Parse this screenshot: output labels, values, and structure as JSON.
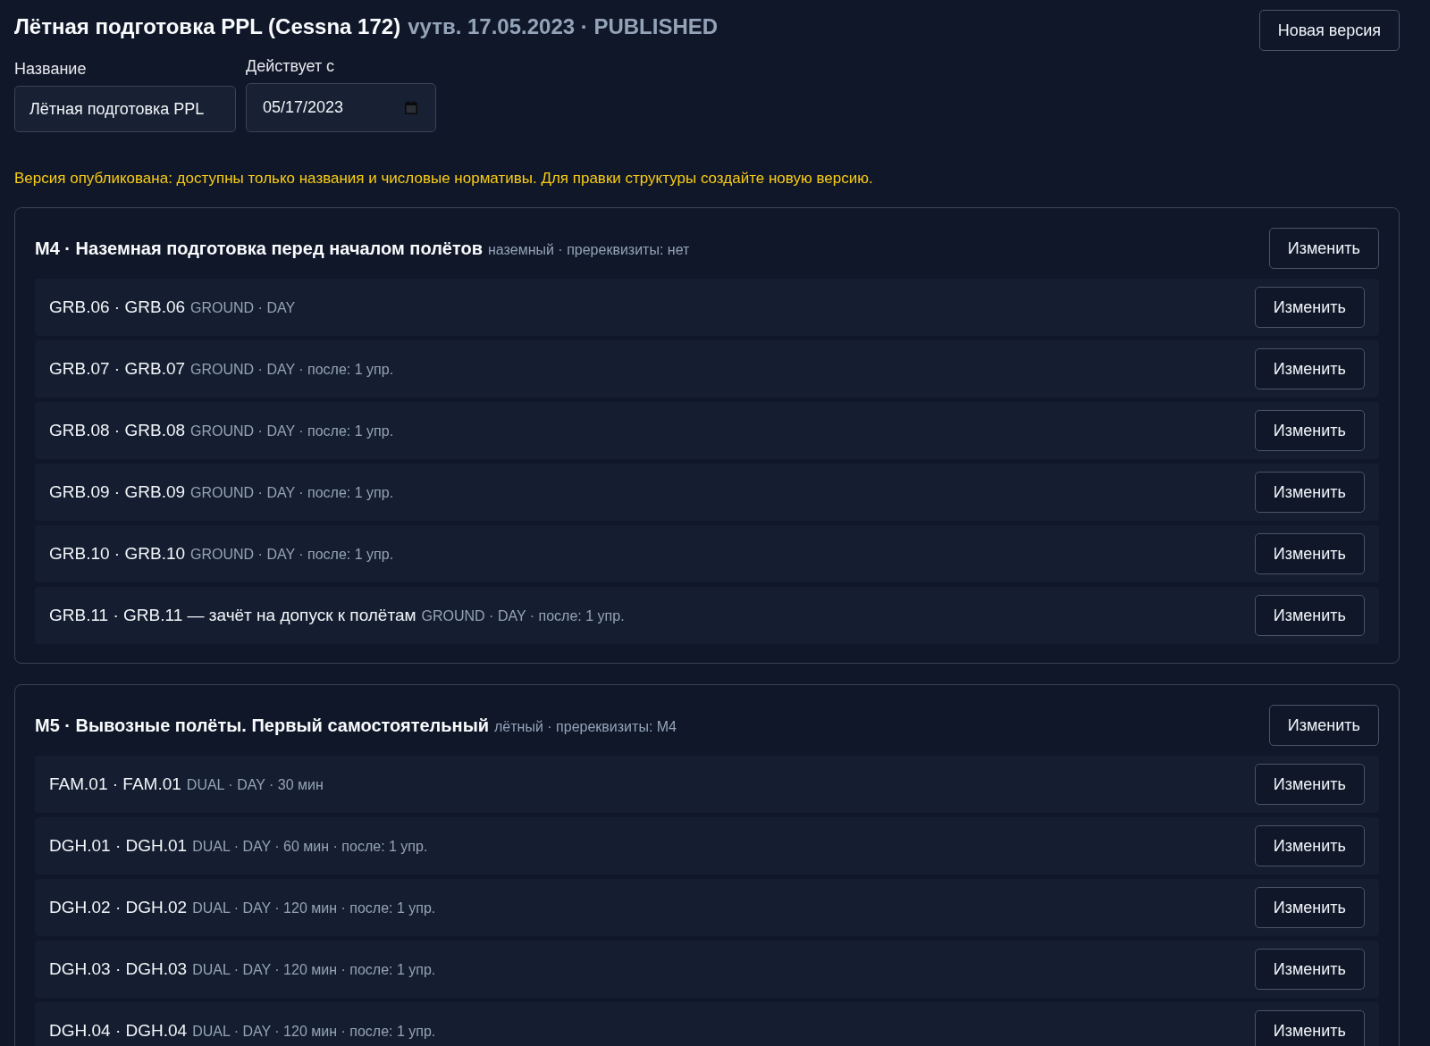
{
  "header": {
    "title": "Лётная подготовка PPL (Cessna 172)",
    "subtitle": "vутв. 17.05.2023 · PUBLISHED",
    "new_version_button": "Новая версия"
  },
  "form": {
    "fields": [
      {
        "kind": "text",
        "label": "Название",
        "value": "Лётная подготовка PPL"
      },
      {
        "kind": "date",
        "label": "Действует с",
        "value": "05/17/2023"
      }
    ]
  },
  "notice": "Версия опубликована: доступны только названия и числовые нормативы. Для правки структуры создайте новую версию.",
  "modules": [
    {
      "title": "M4 · Наземная подготовка перед началом полётов",
      "meta": "наземный · пререквизиты: нет",
      "button": "Изменить",
      "lessons": [
        {
          "title": "GRB.06 · GRB.06",
          "meta": "GROUND · DAY",
          "button": "Изменить"
        },
        {
          "title": "GRB.07 · GRB.07",
          "meta": "GROUND · DAY · после: 1 упр.",
          "button": "Изменить"
        },
        {
          "title": "GRB.08 · GRB.08",
          "meta": "GROUND · DAY · после: 1 упр.",
          "button": "Изменить"
        },
        {
          "title": "GRB.09 · GRB.09",
          "meta": "GROUND · DAY · после: 1 упр.",
          "button": "Изменить"
        },
        {
          "title": "GRB.10 · GRB.10",
          "meta": "GROUND · DAY · после: 1 упр.",
          "button": "Изменить"
        },
        {
          "title": "GRB.11 · GRB.11 — зачёт на допуск к полётам",
          "meta": "GROUND · DAY · после: 1 упр.",
          "button": "Изменить"
        }
      ]
    },
    {
      "title": "M5 · Вывозные полёты. Первый самостоятельный",
      "meta": "лётный · пререквизиты: M4",
      "button": "Изменить",
      "lessons": [
        {
          "title": "FAM.01 · FAM.01",
          "meta": "DUAL · DAY · 30 мин",
          "button": "Изменить"
        },
        {
          "title": "DGH.01 · DGH.01",
          "meta": "DUAL · DAY · 60 мин · после: 1 упр.",
          "button": "Изменить"
        },
        {
          "title": "DGH.02 · DGH.02",
          "meta": "DUAL · DAY · 120 мин · после: 1 упр.",
          "button": "Изменить"
        },
        {
          "title": "DGH.03 · DGH.03",
          "meta": "DUAL · DAY · 120 мин · после: 1 упр.",
          "button": "Изменить"
        },
        {
          "title": "DGH.04 · DGH.04",
          "meta": "DUAL · DAY · 120 мин · после: 1 упр.",
          "button": "Изменить"
        }
      ]
    }
  ]
}
